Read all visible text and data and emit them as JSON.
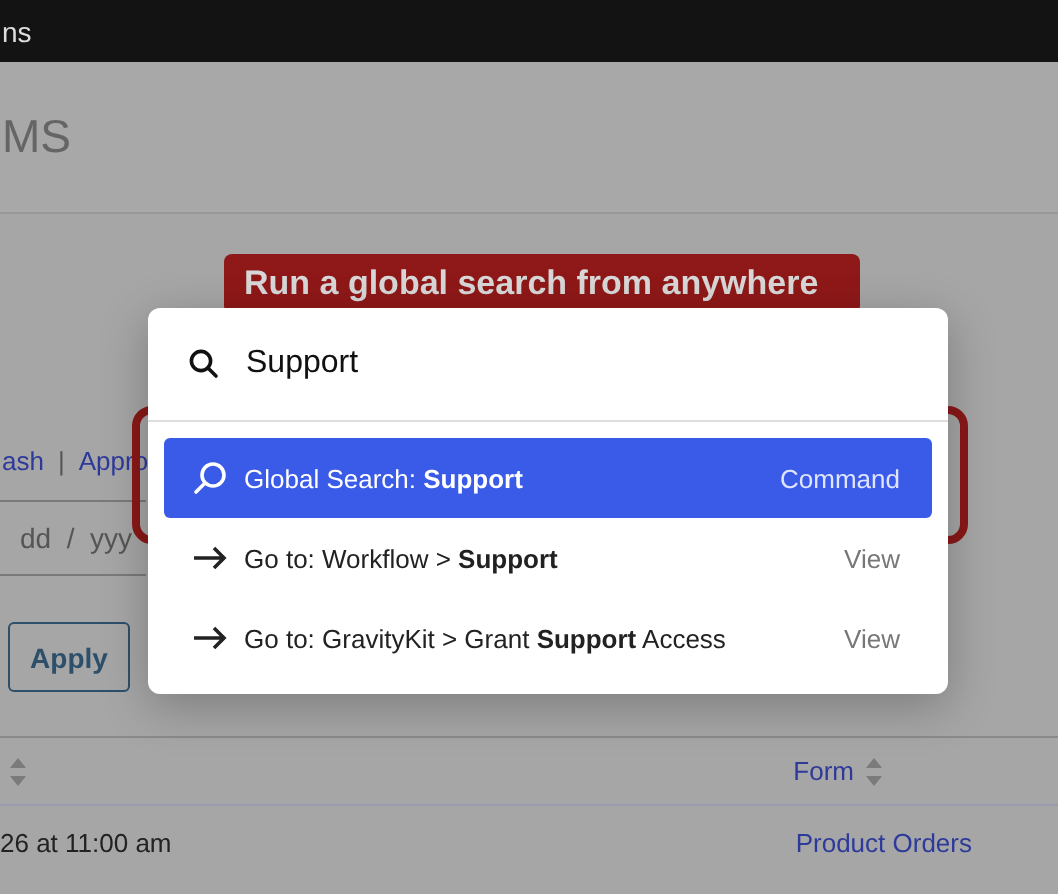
{
  "top_bar": {
    "text": "ns"
  },
  "page_title": "MS",
  "callout": "Run a global search from anywhere",
  "filter_links": [
    {
      "label": "ash"
    },
    {
      "label": "Appro"
    }
  ],
  "filter_separator": "|",
  "date_field": {
    "placeholder": "dd  /  yyy"
  },
  "apply_button": "Apply",
  "table": {
    "columns": [
      {
        "sortable": true
      },
      {
        "label": "Form",
        "sortable": true
      }
    ],
    "rows": [
      {
        "cells": [
          "26 at 11:00 am",
          "Product Orders"
        ]
      }
    ]
  },
  "palette": {
    "query": "Support",
    "results": [
      {
        "kind": "search",
        "text": "Global Search: **Support**",
        "hint": "Command",
        "selected": true
      },
      {
        "kind": "goto",
        "text": "Go to: Workflow > **Support**",
        "hint": "View",
        "selected": false
      },
      {
        "kind": "goto",
        "text": "Go to: GravityKit > Grant **Support** Access",
        "hint": "View",
        "selected": false
      }
    ]
  }
}
